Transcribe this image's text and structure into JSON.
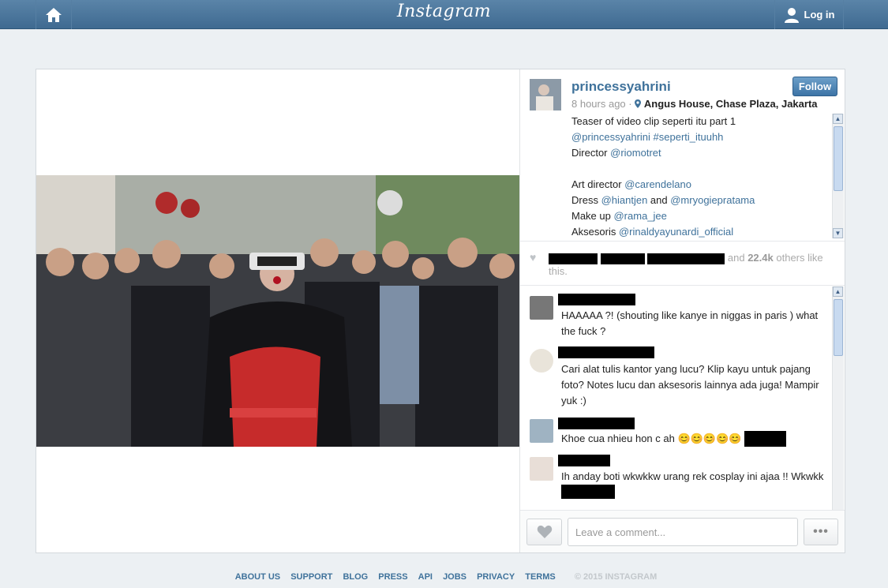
{
  "header": {
    "brand": "Instagram",
    "login_label": "Log in"
  },
  "post": {
    "username": "princessyahrini",
    "time": "8 hours ago",
    "separator": " · ",
    "location": "Angus House, Chase Plaza, Jakarta",
    "follow_label": "Follow",
    "caption": {
      "l1": "Teaser of video clip seperti itu part 1",
      "l2_mention": "@princessyahrini",
      "l2_tag": " #seperti_ituuhh",
      "l3_prefix": "Director ",
      "l3_mention": "@riomotret",
      "l5_prefix": "Art director ",
      "l5_mention": "@carendelano",
      "l6_prefix": "Dress ",
      "l6_mention1": "@hiantjen",
      "l6_mid": " and ",
      "l6_mention2": "@mryogiepratama",
      "l7_prefix": "Make up ",
      "l7_mention": "@rama_jee",
      "l8_prefix": "Aksesoris ",
      "l8_mention": "@rinaldyayunardi_official"
    },
    "likes": {
      "and": "and",
      "count": "22.4k",
      "suffix": "others like this."
    }
  },
  "comments": [
    {
      "text": "HAAAAA ?! (shouting like kanye in niggas in paris ) what the fuck ?"
    },
    {
      "text": "Cari alat tulis kantor yang lucu? Klip kayu untuk pajang foto? Notes lucu dan aksesoris lainnya ada juga! Mampir yuk :)"
    },
    {
      "text": "Khoe cua nhieu hon c ah 😊😊😊😊😊"
    },
    {
      "text": "Ih anday boti wkwkkw urang rek cosplay ini ajaa !! Wkwkk"
    }
  ],
  "composer": {
    "placeholder": "Leave a comment...",
    "more_label": "•••"
  },
  "footer": {
    "links": [
      "ABOUT US",
      "SUPPORT",
      "BLOG",
      "PRESS",
      "API",
      "JOBS",
      "PRIVACY",
      "TERMS"
    ],
    "copyright": "© 2015 INSTAGRAM"
  },
  "colors": {
    "brand_blue": "#3f729b",
    "header_top": "#5a84a8",
    "header_bottom": "#3f6a91",
    "page_bg": "#ecf0f3"
  }
}
